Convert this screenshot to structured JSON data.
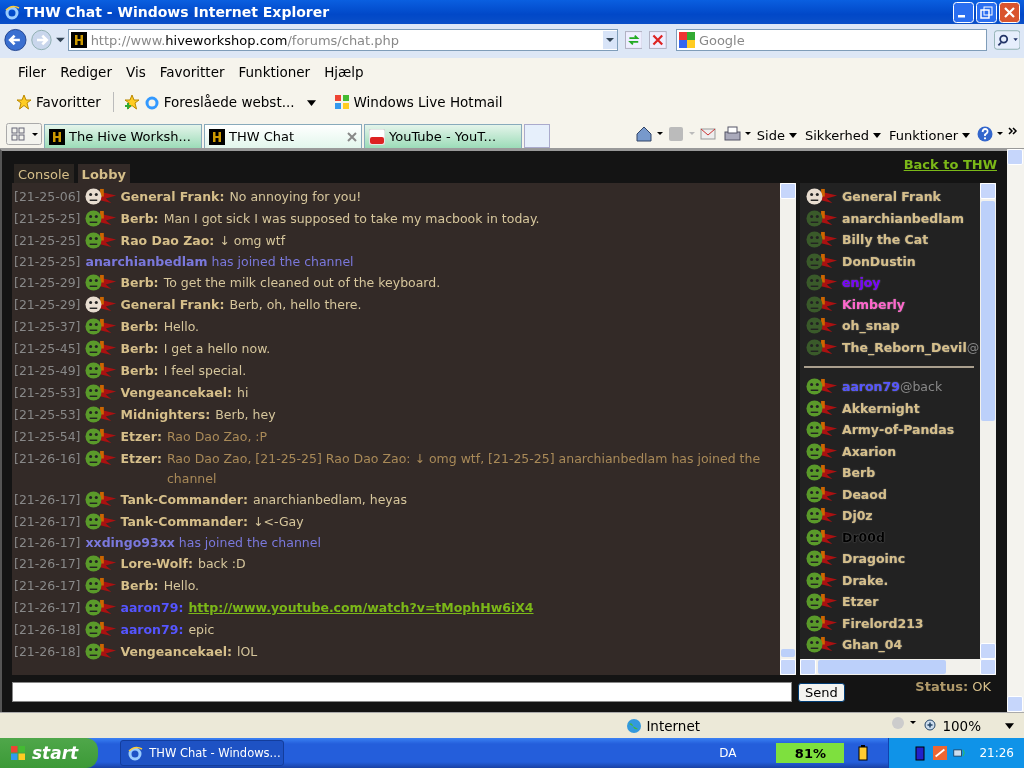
{
  "window": {
    "title": "THW Chat - Windows Internet Explorer"
  },
  "address_bar": {
    "url_prefix": "http://www.",
    "url_domain": "hiveworkshop.com",
    "url_path": "/forums/chat.php"
  },
  "search": {
    "placeholder": "Google"
  },
  "menu": [
    "Filer",
    "Rediger",
    "Vis",
    "Favoritter",
    "Funktioner",
    "Hjælp"
  ],
  "favorites_bar": {
    "favorites": "Favoritter",
    "suggested": "Foreslåede webst...",
    "hotmail": "Windows Live Hotmail"
  },
  "browser_tabs": [
    {
      "label": "The Hive Worksh...",
      "kind": "site",
      "selected": false
    },
    {
      "label": "THW Chat",
      "kind": "site",
      "selected": true
    },
    {
      "label": "YouTube - YouT...",
      "kind": "video",
      "selected": false
    }
  ],
  "command_bar": [
    "Side",
    "Sikkerhed",
    "Funktioner"
  ],
  "chat_tabs": [
    {
      "label": "Console",
      "selected": false
    },
    {
      "label": "Lobby",
      "selected": true
    }
  ],
  "back_link": "Back to THW",
  "messages": [
    {
      "time": "[21-25-06]",
      "kind": "message",
      "avatar": {
        "kind": "skull"
      },
      "name": "General Frank:",
      "color": "#d6bf8a",
      "text": "No annoying for you!"
    },
    {
      "time": "[21-25-25]",
      "kind": "message",
      "avatar": {
        "kind": "orc"
      },
      "name": "Berb:",
      "color": "#d6bf8a",
      "text": "Man I got sick I was supposed to take my macbook in today."
    },
    {
      "time": "[21-25-25]",
      "kind": "message",
      "avatar": {
        "kind": "orc"
      },
      "name": "Rao Dao Zao:",
      "color": "#d6bf8a",
      "text": "↓ omg wtf"
    },
    {
      "time": "[21-25-25]",
      "kind": "join",
      "text": "**anarchianbedlam** has joined the channel"
    },
    {
      "time": "[21-25-29]",
      "kind": "message",
      "avatar": {
        "kind": "orc"
      },
      "name": "Berb:",
      "color": "#d6bf8a",
      "text": "To get the milk cleaned out of the keyboard."
    },
    {
      "time": "[21-25-29]",
      "kind": "message",
      "avatar": {
        "kind": "skull"
      },
      "name": "General Frank:",
      "color": "#d6bf8a",
      "text": "Berb, oh, hello there."
    },
    {
      "time": "[21-25-37]",
      "kind": "message",
      "avatar": {
        "kind": "orc"
      },
      "name": "Berb:",
      "color": "#d6bf8a",
      "text": "Hello."
    },
    {
      "time": "[21-25-45]",
      "kind": "message",
      "avatar": {
        "kind": "orc"
      },
      "name": "Berb:",
      "color": "#d6bf8a",
      "text": "I get a hello now."
    },
    {
      "time": "[21-25-49]",
      "kind": "message",
      "avatar": {
        "kind": "orc"
      },
      "name": "Berb:",
      "color": "#d6bf8a",
      "text": "I feel special."
    },
    {
      "time": "[21-25-53]",
      "kind": "message",
      "avatar": {
        "kind": "orc"
      },
      "name": "Vengeancekael:",
      "color": "#d6bf8a",
      "text": "hi"
    },
    {
      "time": "[21-25-53]",
      "kind": "message",
      "avatar": {
        "kind": "orc"
      },
      "name": "Midnighters:",
      "color": "#d6bf8a",
      "text": "Berb, hey"
    },
    {
      "time": "[21-25-54]",
      "kind": "quote",
      "avatar": {
        "kind": "orc"
      },
      "name": "Etzer:",
      "color": "#d6bf8a",
      "text": "Rao Dao Zao, :P"
    },
    {
      "time": "[21-26-16]",
      "kind": "quote",
      "avatar": {
        "kind": "orc"
      },
      "name": "Etzer:",
      "color": "#d6bf8a",
      "text": "Rao Dao Zao, [21-25-25] Rao Dao Zao: ↓ omg wtf, [21-25-25] anarchianbedlam has joined the channel"
    },
    {
      "time": "[21-26-17]",
      "kind": "message",
      "avatar": {
        "kind": "orc"
      },
      "name": "Tank-Commander:",
      "color": "#d6bf8a",
      "text": "anarchianbedlam, heyas"
    },
    {
      "time": "[21-26-17]",
      "kind": "message",
      "avatar": {
        "kind": "orc"
      },
      "name": "Tank-Commander:",
      "color": "#d6bf8a",
      "text": "↓<-Gay"
    },
    {
      "time": "[21-26-17]",
      "kind": "join",
      "text": "**xxdingo93xx** has joined the channel"
    },
    {
      "time": "[21-26-17]",
      "kind": "message",
      "avatar": {
        "kind": "orc"
      },
      "name": "Lore-Wolf:",
      "color": "#d6bf8a",
      "text": "back :D"
    },
    {
      "time": "[21-26-17]",
      "kind": "message",
      "avatar": {
        "kind": "orc"
      },
      "name": "Berb:",
      "color": "#d6bf8a",
      "text": "Hello."
    },
    {
      "time": "[21-26-17]",
      "kind": "link",
      "avatar": {
        "kind": "orc"
      },
      "name": "aaron79:",
      "color": "#5555ff",
      "text": "http://www.youtube.com/watch?v=tMophHw6iX4"
    },
    {
      "time": "[21-26-18]",
      "kind": "message",
      "avatar": {
        "kind": "orc"
      },
      "name": "aaron79:",
      "color": "#5555ff",
      "text": "epic"
    },
    {
      "time": "[21-26-18]",
      "kind": "message",
      "avatar": {
        "kind": "orc"
      },
      "name": "Vengeancekael:",
      "color": "#d6bf8a",
      "text": "lOL"
    }
  ],
  "user_groups": [
    {
      "users": [
        {
          "name": "General Frank",
          "avatar": {
            "kind": "skull"
          },
          "color": "#d6bf8a"
        },
        {
          "name": "anarchianbedlam",
          "avatar": {
            "kind": "dark"
          },
          "color": "#d6bf8a"
        },
        {
          "name": "Billy the Cat",
          "avatar": {
            "kind": "dark"
          },
          "color": "#d6bf8a"
        },
        {
          "name": "DonDustin",
          "avatar": {
            "kind": "dark"
          },
          "color": "#d6bf8a"
        },
        {
          "name": "enjoy",
          "avatar": {
            "kind": "dark"
          },
          "color": "#7700ff"
        },
        {
          "name": "Kimberly",
          "avatar": {
            "kind": "dark"
          },
          "color": "#ff66cc"
        },
        {
          "name": "oh_snap",
          "avatar": {
            "kind": "dark"
          },
          "color": "#d6bf8a"
        },
        {
          "name": "The_Reborn_Devil",
          "suffix": "@",
          "avatar": {
            "kind": "dark"
          },
          "color": "#d6bf8a"
        }
      ]
    },
    {
      "users": [
        {
          "name": "aaron79",
          "suffix": "@back",
          "avatar": {
            "kind": "orc"
          },
          "color": "#5555ff"
        },
        {
          "name": "Akkernight",
          "avatar": {
            "kind": "orc"
          },
          "color": "#d6bf8a"
        },
        {
          "name": "Army-of-Pandas",
          "avatar": {
            "kind": "orc"
          },
          "color": "#d6bf8a"
        },
        {
          "name": "Axarion",
          "avatar": {
            "kind": "orc"
          },
          "color": "#d6bf8a"
        },
        {
          "name": "Berb",
          "avatar": {
            "kind": "orc"
          },
          "color": "#d6bf8a"
        },
        {
          "name": "Deaod",
          "avatar": {
            "kind": "orc"
          },
          "color": "#d6bf8a"
        },
        {
          "name": "Dj0z",
          "avatar": {
            "kind": "orc"
          },
          "color": "#d6bf8a"
        },
        {
          "name": "Dr00d",
          "avatar": {
            "kind": "orc"
          },
          "color": "#000000"
        },
        {
          "name": "Dragoinc",
          "avatar": {
            "kind": "orc"
          },
          "color": "#d6bf8a"
        },
        {
          "name": "Drake.",
          "avatar": {
            "kind": "orc"
          },
          "color": "#d6bf8a"
        },
        {
          "name": "Etzer",
          "avatar": {
            "kind": "orc"
          },
          "color": "#d6bf8a"
        },
        {
          "name": "Firelord213",
          "avatar": {
            "kind": "orc"
          },
          "color": "#d6bf8a"
        },
        {
          "name": "Ghan_04",
          "avatar": {
            "kind": "orc"
          },
          "color": "#d6bf8a"
        }
      ]
    }
  ],
  "send_button": "Send",
  "status": {
    "label": "Status:",
    "value": "OK"
  },
  "status_bar": {
    "zone": "Internet",
    "zoom": "100%"
  },
  "taskbar": {
    "start": "start",
    "task": "THW Chat - Windows...",
    "language": "DA",
    "battery": "81%",
    "clock": "21:26"
  }
}
